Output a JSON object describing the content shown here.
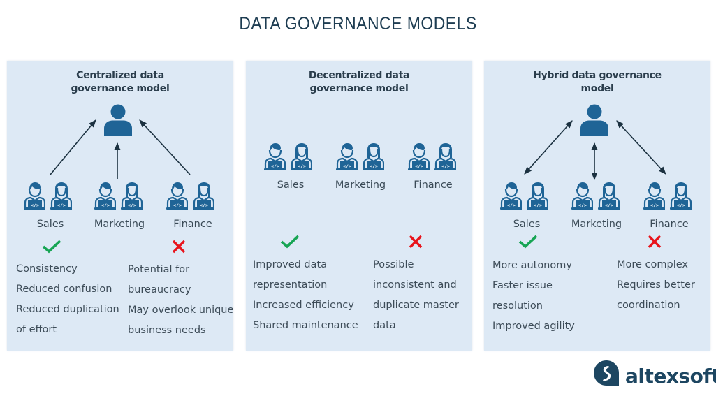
{
  "title": "DATA GOVERNANCE MODELS",
  "colors": {
    "panel_bg": "#dde9f5",
    "icon_blue": "#1f6496",
    "arrow": "#1b3140",
    "check_green": "#17a554",
    "cross_red": "#e8141c",
    "brand": "#1d4661"
  },
  "panels": [
    {
      "title_line1": "Centralized data",
      "title_line2": "governance model",
      "arrow_type": "one-way-up",
      "departments": [
        "Sales",
        "Marketing",
        "Finance"
      ],
      "pros_icon": "check-icon",
      "cons_icon": "cross-icon",
      "pros": [
        "Consistency",
        "Reduced confusion",
        "Reduced duplication",
        "of effort"
      ],
      "cons": [
        "Potential for",
        "bureaucracy",
        "May overlook unique",
        "business needs"
      ]
    },
    {
      "title_line1": "Decentralized data",
      "title_line2": "governance model",
      "arrow_type": "none",
      "departments": [
        "Sales",
        "Marketing",
        "Finance"
      ],
      "pros_icon": "check-icon",
      "cons_icon": "cross-icon",
      "pros": [
        "Improved data",
        "representation",
        "Increased efficiency",
        "Shared maintenance"
      ],
      "cons": [
        "Possible",
        "inconsistent and",
        "duplicate master",
        "data"
      ]
    },
    {
      "title_line1": "Hybrid data governance",
      "title_line2": "model",
      "arrow_type": "two-way",
      "departments": [
        "Sales",
        "Marketing",
        "Finance"
      ],
      "pros_icon": "check-icon",
      "cons_icon": "cross-icon",
      "pros": [
        "More autonomy",
        "Faster issue",
        "resolution",
        "Improved agility"
      ],
      "cons": [
        "More complex",
        "Requires better",
        "coordination"
      ]
    }
  ],
  "icons": {
    "leader": "person-icon",
    "worker_male": "developer-male-icon",
    "worker_female": "developer-female-icon",
    "laptop_code": "</>"
  },
  "logo": {
    "text": "altexsoft",
    "icon": "altexsoft-logo-icon"
  }
}
